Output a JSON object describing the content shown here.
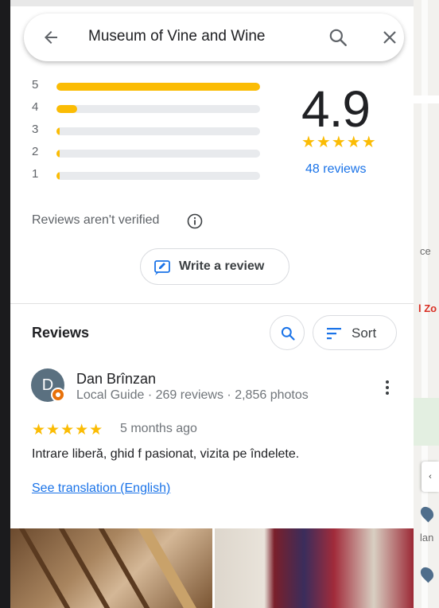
{
  "search": {
    "query": "Museum of Vine and Wine"
  },
  "rating": {
    "value": "4.9",
    "stars": "★★★★★",
    "reviews_link": "48 reviews",
    "distribution": [
      {
        "stars": "5",
        "fraction": 1.0
      },
      {
        "stars": "4",
        "fraction": 0.1
      },
      {
        "stars": "3",
        "fraction": 0.0
      },
      {
        "stars": "2",
        "fraction": 0.0
      },
      {
        "stars": "1",
        "fraction": 0.0
      }
    ],
    "bar_color": "#fbbc04"
  },
  "notice": {
    "text": "Reviews aren't verified",
    "icon": "info-icon"
  },
  "write_review": {
    "label": "Write a review",
    "icon": "edit-review-icon"
  },
  "reviews_section": {
    "title": "Reviews",
    "search_icon": "search-icon",
    "sort_label": "Sort",
    "sort_icon": "sort-icon"
  },
  "review": {
    "avatar_initial": "D",
    "name": "Dan Brînzan",
    "meta": "Local Guide · 269 reviews · 2,856 photos",
    "stars": "★★★★★",
    "time": "5 months ago",
    "text": "Intrare liberă, ghid f pasionat, vizita pe îndelete.",
    "translation_link": "See translation (English)"
  },
  "map": {
    "label_a": "ce",
    "label_b": "l Zo",
    "label_c": "lan",
    "nav_glyph": "‹"
  },
  "colors": {
    "accent": "#1a73e8",
    "star": "#fbbc04",
    "guide_badge": "#e8710a"
  }
}
